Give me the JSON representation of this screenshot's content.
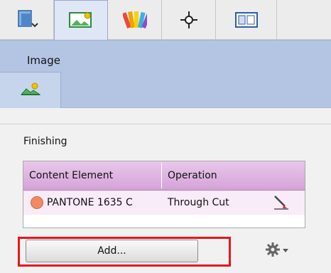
{
  "ribbon": {
    "label": "Image"
  },
  "section": {
    "title": "Finishing"
  },
  "table": {
    "columns": [
      "Content Element",
      "Operation"
    ],
    "rows": [
      {
        "content_element": "PANTONE 1635 C",
        "operation": "Through Cut",
        "swatch_color": "#f28a61"
      }
    ]
  },
  "actions": {
    "add_label": "Add..."
  },
  "icons": [
    "panel-icon",
    "image-tab-icon",
    "color-swatches-icon",
    "crosshair-icon",
    "layout-icon",
    "image-icon",
    "edit-icon",
    "gear-icon",
    "chevron-down-icon"
  ],
  "colors": {
    "table_header": "#d5a3d8",
    "ribbon": "#b4c5e3",
    "highlight": "#e8161c"
  }
}
